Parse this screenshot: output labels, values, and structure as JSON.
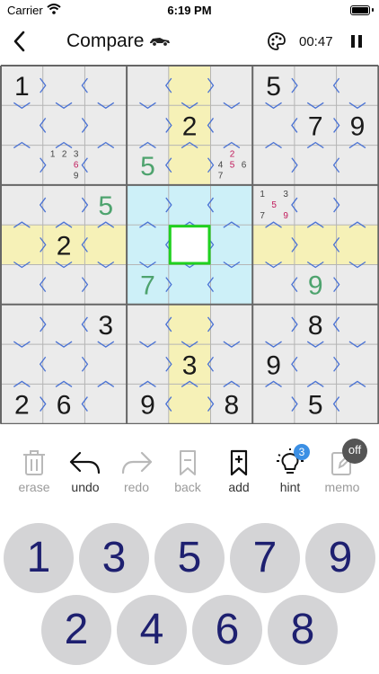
{
  "status_bar": {
    "carrier": "Carrier",
    "time": "6:19 PM"
  },
  "header": {
    "title": "Compare",
    "timer": "00:47",
    "car_icon": "race-car-icon",
    "palette_icon": "palette-icon"
  },
  "colors": {
    "highlight_row_col": "#f6f1b7",
    "highlight_box": "#cdf0f8",
    "selected_border": "#1fd11f",
    "given": "#1a1a1a",
    "user_entry": "#4ea36e",
    "memo_conflict": "#c0185a",
    "chevron": "#4a72d4",
    "grid_bg": "#ebebeb"
  },
  "board": {
    "givens": [
      {
        "r": 0,
        "c": 0,
        "v": "1"
      },
      {
        "r": 0,
        "c": 6,
        "v": "5"
      },
      {
        "r": 1,
        "c": 4,
        "v": "2"
      },
      {
        "r": 1,
        "c": 7,
        "v": "7"
      },
      {
        "r": 1,
        "c": 8,
        "v": "9"
      },
      {
        "r": 4,
        "c": 1,
        "v": "2"
      },
      {
        "r": 6,
        "c": 2,
        "v": "3"
      },
      {
        "r": 6,
        "c": 7,
        "v": "8"
      },
      {
        "r": 7,
        "c": 4,
        "v": "3"
      },
      {
        "r": 7,
        "c": 6,
        "v": "9"
      },
      {
        "r": 8,
        "c": 0,
        "v": "2"
      },
      {
        "r": 8,
        "c": 1,
        "v": "6"
      },
      {
        "r": 8,
        "c": 3,
        "v": "9"
      },
      {
        "r": 8,
        "c": 5,
        "v": "8"
      },
      {
        "r": 8,
        "c": 7,
        "v": "5"
      }
    ],
    "entries": [
      {
        "r": 2,
        "c": 3,
        "v": "5"
      },
      {
        "r": 3,
        "c": 2,
        "v": "5"
      },
      {
        "r": 5,
        "c": 3,
        "v": "7"
      },
      {
        "r": 5,
        "c": 7,
        "v": "9"
      }
    ],
    "memos": [
      {
        "r": 2,
        "c": 1,
        "digits": [
          "1",
          "2",
          "3",
          "6",
          "9"
        ],
        "red": [
          "6"
        ]
      },
      {
        "r": 2,
        "c": 5,
        "digits": [
          "2",
          "4",
          "5",
          "6",
          "7"
        ],
        "red": [
          "2",
          "5"
        ]
      },
      {
        "r": 3,
        "c": 6,
        "digits": [
          "1",
          "3",
          "5",
          "7",
          "9"
        ],
        "red": [
          "5",
          "9"
        ]
      }
    ],
    "selected": {
      "r": 4,
      "c": 4
    }
  },
  "toolbar": [
    {
      "id": "erase",
      "label": "erase",
      "icon": "trash-icon",
      "enabled": false
    },
    {
      "id": "undo",
      "label": "undo",
      "icon": "undo-arrow-icon",
      "enabled": true
    },
    {
      "id": "redo",
      "label": "redo",
      "icon": "redo-arrow-icon",
      "enabled": false
    },
    {
      "id": "back",
      "label": "back",
      "icon": "bookmark-back-icon",
      "enabled": false
    },
    {
      "id": "add",
      "label": "add",
      "icon": "bookmark-add-icon",
      "enabled": true
    },
    {
      "id": "hint",
      "label": "hint",
      "icon": "lightbulb-icon",
      "enabled": true,
      "badge": "3"
    },
    {
      "id": "memo",
      "label": "memo",
      "icon": "pencil-icon",
      "enabled": false,
      "badge": "off"
    }
  ],
  "keypad": [
    "1",
    "3",
    "5",
    "7",
    "9",
    "2",
    "4",
    "6",
    "8"
  ]
}
